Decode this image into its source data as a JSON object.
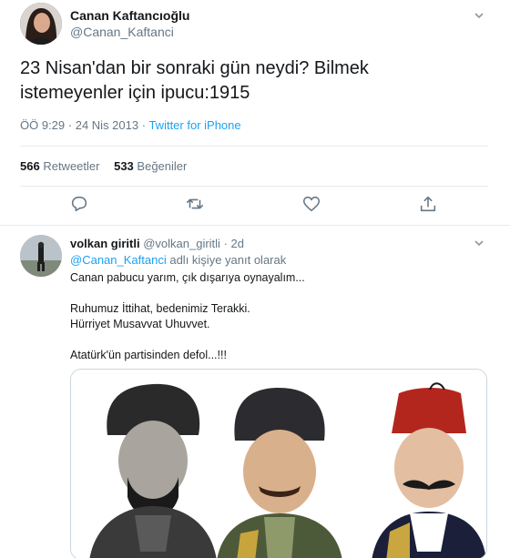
{
  "main_tweet": {
    "author_name": "Canan Kaftancıoğlu",
    "author_handle": "@Canan_Kaftanci",
    "text_line1": "23 Nisan'dan bir sonraki gün neydi? Bilmek",
    "text_line2": "istemeyenler için ipucu:1915",
    "time": "ÖÖ 9:29",
    "date": "24 Nis 2013",
    "source": "Twitter for iPhone",
    "retweet_count": "566",
    "retweet_label": "Retweetler",
    "like_count": "533",
    "like_label": "Beğeniler",
    "icons": {
      "reply": "reply-icon",
      "retweet": "retweet-icon",
      "like": "heart-icon",
      "share": "share-icon",
      "menu": "chevron-down-icon"
    }
  },
  "reply_tweet": {
    "author_name": "volkan giritli",
    "author_handle": "@volkan_giritli",
    "time_ago": "2d",
    "replying_mention": "@Canan_Kaftanci",
    "replying_suffix": "adlı kişiye yanıt olarak",
    "line1": "Canan pabucu yarım, çık dışarıya oynayalım...",
    "line2": "Ruhumuz İttihat, bedenimiz Terakki.",
    "line3": "Hürriyet Musavvat Uhuvvet.",
    "line4": "Atatürk'ün partisinden defol...!!!"
  },
  "colors": {
    "link": "#1da1f2",
    "secondary_text": "#657786",
    "primary_text": "#14171a",
    "divider": "#e6ecf0"
  }
}
